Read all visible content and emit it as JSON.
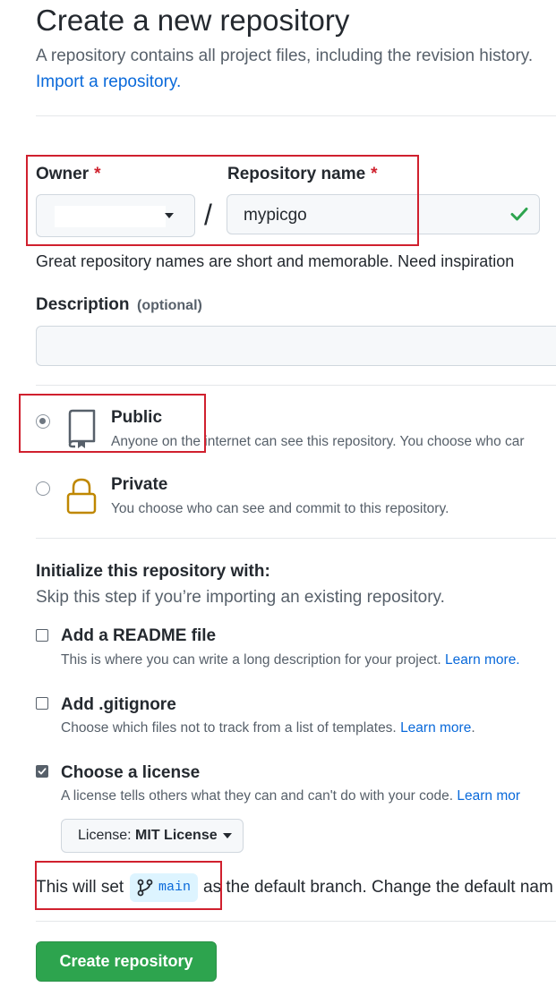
{
  "header": {
    "title": "Create a new repository",
    "subtitle": "A repository contains all project files, including the revision history.",
    "import_link": "Import a repository."
  },
  "owner": {
    "label": "Owner",
    "required_mark": "*",
    "value": ""
  },
  "slash": "/",
  "repo_name": {
    "label": "Repository name",
    "required_mark": "*",
    "value": "mypicgo",
    "hint": "Great repository names are short and memorable. Need inspiration"
  },
  "description": {
    "label": "Description",
    "optional": "(optional)",
    "value": ""
  },
  "visibility": {
    "public": {
      "title": "Public",
      "desc": "Anyone on the internet can see this repository. You choose who car",
      "selected": true
    },
    "private": {
      "title": "Private",
      "desc": "You choose who can see and commit to this repository.",
      "selected": false
    }
  },
  "init": {
    "heading": "Initialize this repository with:",
    "subheading": "Skip this step if you’re importing an existing repository.",
    "readme": {
      "title": "Add a README file",
      "desc": "This is where you can write a long description for your project.",
      "link": "Learn more.",
      "checked": false
    },
    "gitignore": {
      "title": "Add .gitignore",
      "desc": "Choose which files not to track from a list of templates.",
      "link": "Learn more",
      "link_suffix": ".",
      "checked": false
    },
    "license": {
      "title": "Choose a license",
      "desc": "A license tells others what they can and can't do with your code.",
      "link": "Learn mor",
      "checked": true,
      "button_prefix": "License:",
      "button_value": "MIT License"
    }
  },
  "branch": {
    "prefix": "This will set",
    "name": "main",
    "suffix": "as the default branch. Change the default nam"
  },
  "submit_label": "Create repository",
  "colors": {
    "primary_button": "#2da44e",
    "link": "#0969da",
    "success": "#2da44e",
    "lock": "#bf8700",
    "annotation_red": "#d0202e"
  }
}
